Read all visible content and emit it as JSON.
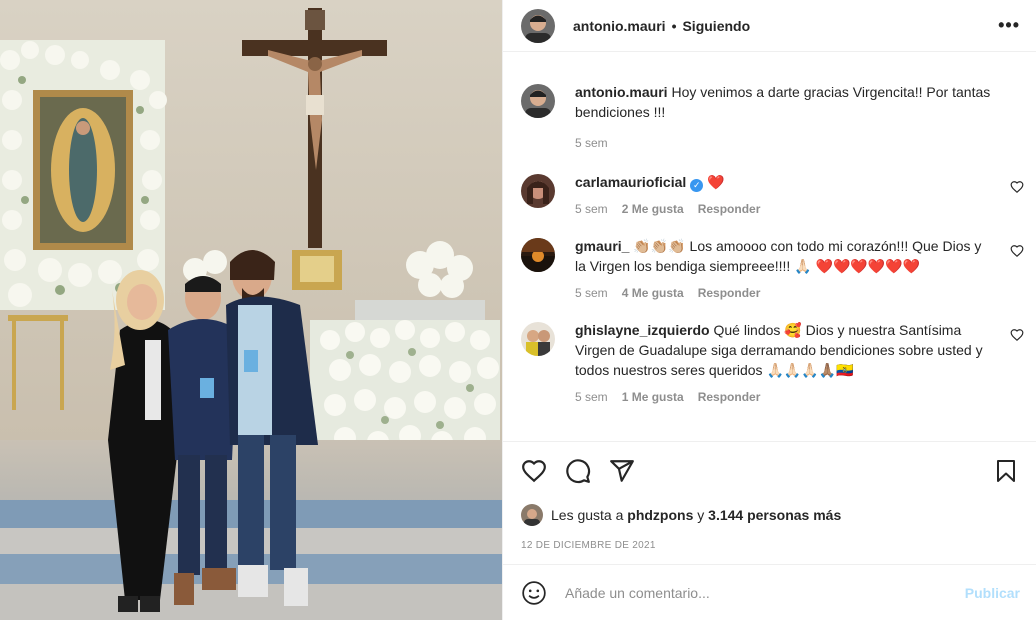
{
  "post": {
    "author": "antonio.mauri",
    "follow_status": "Siguiendo",
    "more_label": "•••",
    "caption": {
      "username": "antonio.mauri",
      "text": "Hoy venimos a darte gracias Virgencita!! Por tantas bendiciones !!!",
      "time": "5 sem"
    }
  },
  "comments": [
    {
      "username": "carlamaurioficial",
      "verified": true,
      "text": "❤️",
      "time": "5 sem",
      "likes": "2 Me gusta",
      "reply": "Responder"
    },
    {
      "username": "gmauri_",
      "text": "👏🏼👏🏼👏🏼 Los amoooo con todo mi corazón!!! Que Dios y la Virgen los bendiga siempreee!!!! 🙏🏻 ❤️❤️❤️❤️❤️❤️",
      "time": "5 sem",
      "likes": "4 Me gusta",
      "reply": "Responder"
    },
    {
      "username": "ghislayne_izquierdo",
      "text": "Qué lindos 🥰 Dios y nuestra Santísima Virgen de Guadalupe siga derramando bendiciones sobre usted y todos nuestros seres queridos 🙏🏻🙏🏻🙏🏻🙏🏽🇪🇨",
      "time": "5 sem",
      "likes": "1 Me gusta",
      "reply": "Responder"
    }
  ],
  "likes_line": {
    "prefix": "Les gusta a",
    "user": "phdzpons",
    "conj": "y",
    "others": "3.144 personas más"
  },
  "date": "12 DE DICIEMBRE DE 2021",
  "composer": {
    "placeholder": "Añade un comentario...",
    "publish": "Publicar"
  },
  "colors": {
    "accent": "#0095f6",
    "publish_disabled": "#b2dffc",
    "like_red": "#ed4956",
    "muted": "#8e8e8e"
  },
  "icons": [
    "heart-icon",
    "comment-icon",
    "share-icon",
    "bookmark-icon",
    "emoji-icon",
    "verified-icon"
  ]
}
